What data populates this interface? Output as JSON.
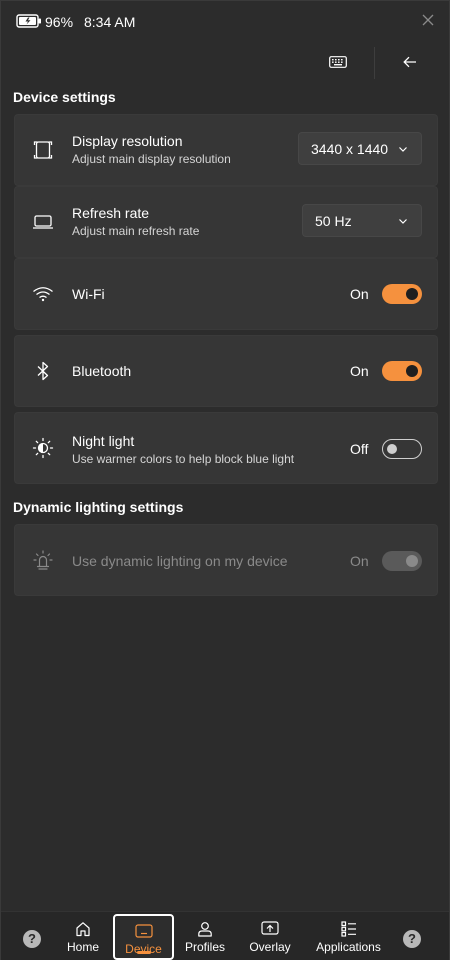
{
  "statusbar": {
    "battery_percent": "96%",
    "time": "8:34 AM",
    "close_icon": "close-icon"
  },
  "header": {
    "keyboard_icon": "keyboard-icon",
    "back_icon": "back-arrow-icon"
  },
  "device_settings": {
    "title": "Device settings",
    "display": {
      "title": "Display resolution",
      "subtitle": "Adjust main display resolution",
      "value": "3440 x 1440",
      "icon": "display-resolution-icon"
    },
    "refresh": {
      "title": "Refresh rate",
      "subtitle": "Adjust main refresh rate",
      "value": "50 Hz",
      "icon": "laptop-icon"
    },
    "wifi": {
      "title": "Wi-Fi",
      "state": "On",
      "on": true,
      "icon": "wifi-icon"
    },
    "bluetooth": {
      "title": "Bluetooth",
      "state": "On",
      "on": true,
      "icon": "bluetooth-icon"
    },
    "night_light": {
      "title": "Night light",
      "subtitle": "Use warmer colors to help block blue light",
      "state": "Off",
      "on": false,
      "icon": "night-light-icon"
    }
  },
  "dynamic_lighting": {
    "title": "Dynamic lighting settings",
    "setting": {
      "title": "Use dynamic lighting on my device",
      "state": "On",
      "on": true,
      "disabled": true,
      "icon": "lighting-icon"
    }
  },
  "nav": {
    "items": [
      {
        "label": "Home",
        "icon": "home-icon",
        "active": false
      },
      {
        "label": "Device",
        "icon": "device-icon",
        "active": true
      },
      {
        "label": "Profiles",
        "icon": "profile-icon",
        "active": false
      },
      {
        "label": "Overlay",
        "icon": "overlay-icon",
        "active": false
      },
      {
        "label": "Applications",
        "icon": "applications-icon",
        "active": false
      }
    ],
    "help_left": "?",
    "help_right": "?"
  },
  "colors": {
    "accent": "#f5913e",
    "background": "#2c2c2c",
    "card": "#363636"
  }
}
